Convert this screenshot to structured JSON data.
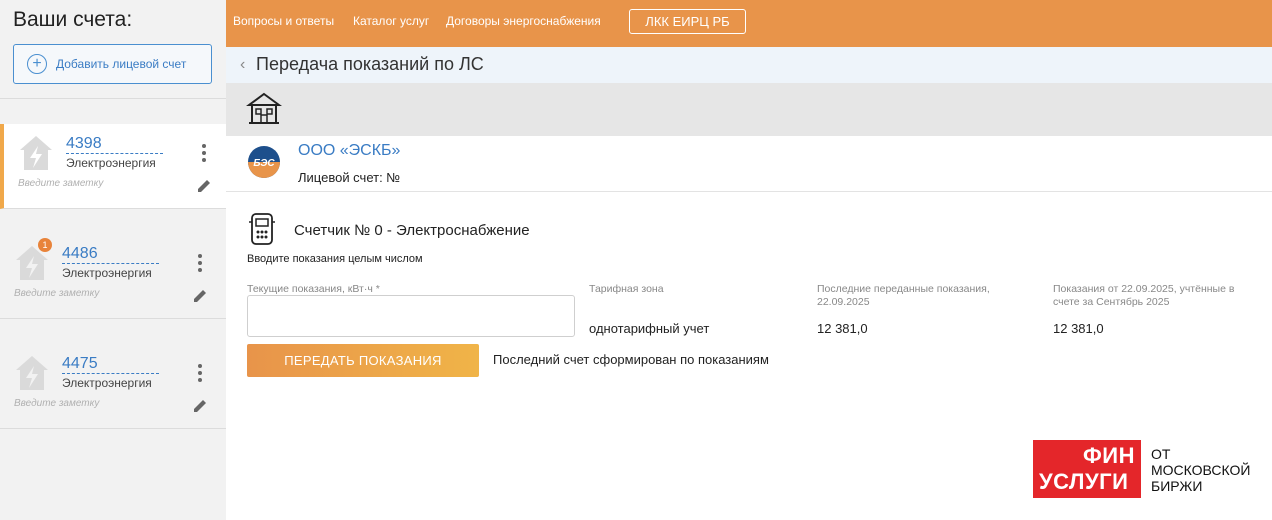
{
  "sidebar": {
    "title": "Ваши счета:",
    "add_button": "Добавить лицевой счет",
    "accounts": [
      {
        "number": "4398",
        "type": "Электроэнергия",
        "note_placeholder": "Введите заметку",
        "badge": ""
      },
      {
        "number": "4486",
        "type": "Электроэнергия",
        "note_placeholder": "Введите заметку",
        "badge": "1"
      },
      {
        "number": "4475",
        "type": "Электроэнергия",
        "note_placeholder": "Введите заметку",
        "badge": ""
      }
    ]
  },
  "topbar": {
    "links": [
      "Вопросы и ответы",
      "Каталог услуг",
      "Договоры энергоснабжения"
    ],
    "lkk_button": "ЛКК ЕИРЦ РБ"
  },
  "page": {
    "back_icon": "chevron-left-icon",
    "title": "Передача показаний по ЛС"
  },
  "org": {
    "logo_text": "БЭС",
    "name": "ООО «ЭСКБ»",
    "account_label": "Лицевой счет: №"
  },
  "meter": {
    "title": "Счетчик № 0 - Электроснабжение",
    "hint": "Вводите показания целым числом",
    "input_label": "Текущие показания, кВт·ч *",
    "input_value": "",
    "tariff_label": "Тарифная зона",
    "tariff_value": "однотарифный учет",
    "last_label": "Последние переданные показания, 22.09.2025",
    "last_value": "12 381,0",
    "counted_label": "Показания от 22.09.2025, учтённые в счете за Сентябрь 2025",
    "counted_value": "12 381,0",
    "submit": "ПЕРЕДАТЬ ПОКАЗАНИЯ",
    "last_bill": "Последний счет сформирован по показаниям"
  },
  "watermark": {
    "fin_line1": "ФИН",
    "fin_line2": "УСЛУГИ",
    "moex_line1": "ОТ",
    "moex_line2": "МОСКОВСКОЙ",
    "moex_line3": "БИРЖИ"
  },
  "colors": {
    "accent": "#e8944a",
    "link": "#3a7cc4",
    "badge": "#e8833a",
    "watermark_red": "#e4262a"
  }
}
